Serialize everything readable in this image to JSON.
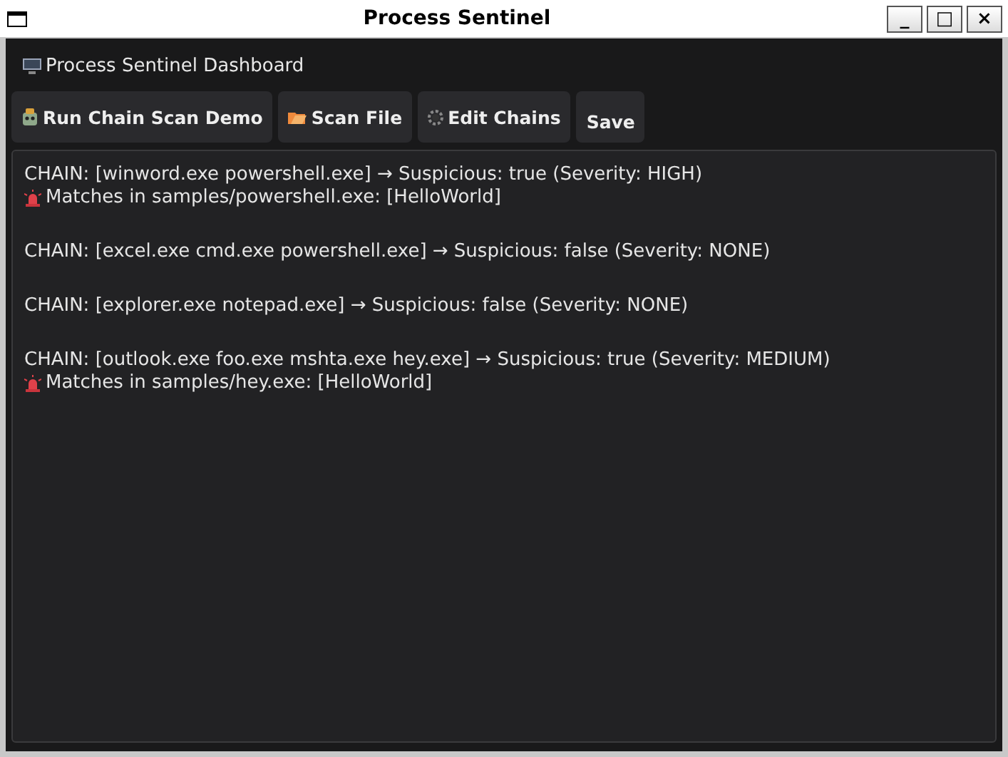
{
  "window": {
    "title": "Process Sentinel",
    "controls": [
      "_",
      "□",
      "×"
    ]
  },
  "header": {
    "title": "Process Sentinel Dashboard"
  },
  "toolbar": [
    {
      "label": "Run Chain Scan Demo"
    },
    {
      "label": "Scan File"
    },
    {
      "label": "Edit Chains"
    },
    {
      "label": "Save"
    }
  ],
  "output": [
    {
      "chain": "CHAIN: [winword.exe powershell.exe] → Suspicious: true (Severity: HIGH)",
      "match": "Matches in samples/powershell.exe: [HelloWorld]"
    },
    {
      "chain": "CHAIN: [excel.exe cmd.exe powershell.exe] → Suspicious: false (Severity: NONE)"
    },
    {
      "chain": "CHAIN: [explorer.exe notepad.exe] → Suspicious: false (Severity: NONE)"
    },
    {
      "chain": "CHAIN: [outlook.exe foo.exe mshta.exe hey.exe] → Suspicious: true (Severity: MEDIUM)",
      "match": "Matches in samples/hey.exe: [HelloWorld]"
    }
  ]
}
